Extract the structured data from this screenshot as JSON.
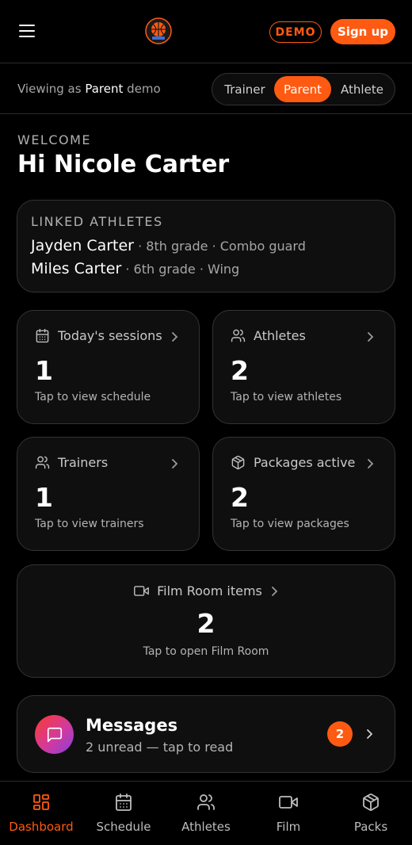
{
  "header": {
    "demo_badge": "DEMO",
    "signup_label": "Sign up"
  },
  "role_bar": {
    "viewing_prefix": "Viewing as",
    "viewing_role": "Parent",
    "viewing_suffix": "demo",
    "options": [
      "Trainer",
      "Parent",
      "Athlete"
    ],
    "selected": "Parent"
  },
  "welcome": {
    "label": "WELCOME",
    "title": "Hi Nicole Carter"
  },
  "linked_athletes": {
    "label": "LINKED ATHLETES",
    "items": [
      {
        "name": "Jayden Carter",
        "meta": " · 8th grade · Combo guard"
      },
      {
        "name": "Miles Carter",
        "meta": " · 6th grade · Wing"
      }
    ]
  },
  "stats": [
    {
      "title": "Today's sessions",
      "value": "1",
      "sub": "Tap to view schedule",
      "icon": "calendar-icon"
    },
    {
      "title": "Athletes",
      "value": "2",
      "sub": "Tap to view athletes",
      "icon": "users-icon"
    },
    {
      "title": "Trainers",
      "value": "1",
      "sub": "Tap to view trainers",
      "icon": "users-icon"
    },
    {
      "title": "Packages active",
      "value": "2",
      "sub": "Tap to view packages",
      "icon": "package-icon"
    }
  ],
  "film_room": {
    "title": "Film Room items",
    "value": "2",
    "sub": "Tap to open Film Room",
    "icon": "video-icon"
  },
  "messages": {
    "title": "Messages",
    "sub": "2 unread — tap to read",
    "badge": "2",
    "icon": "message-icon"
  },
  "bottom_nav": {
    "items": [
      {
        "label": "Dashboard",
        "icon": "dashboard-icon"
      },
      {
        "label": "Schedule",
        "icon": "calendar-icon"
      },
      {
        "label": "Athletes",
        "icon": "users-icon"
      },
      {
        "label": "Film",
        "icon": "video-icon"
      },
      {
        "label": "Packs",
        "icon": "package-icon"
      }
    ],
    "active": "Dashboard"
  },
  "colors": {
    "accent": "#ff5a12",
    "background": "#000000",
    "card": "#0f0f0f",
    "border": "#333333"
  }
}
